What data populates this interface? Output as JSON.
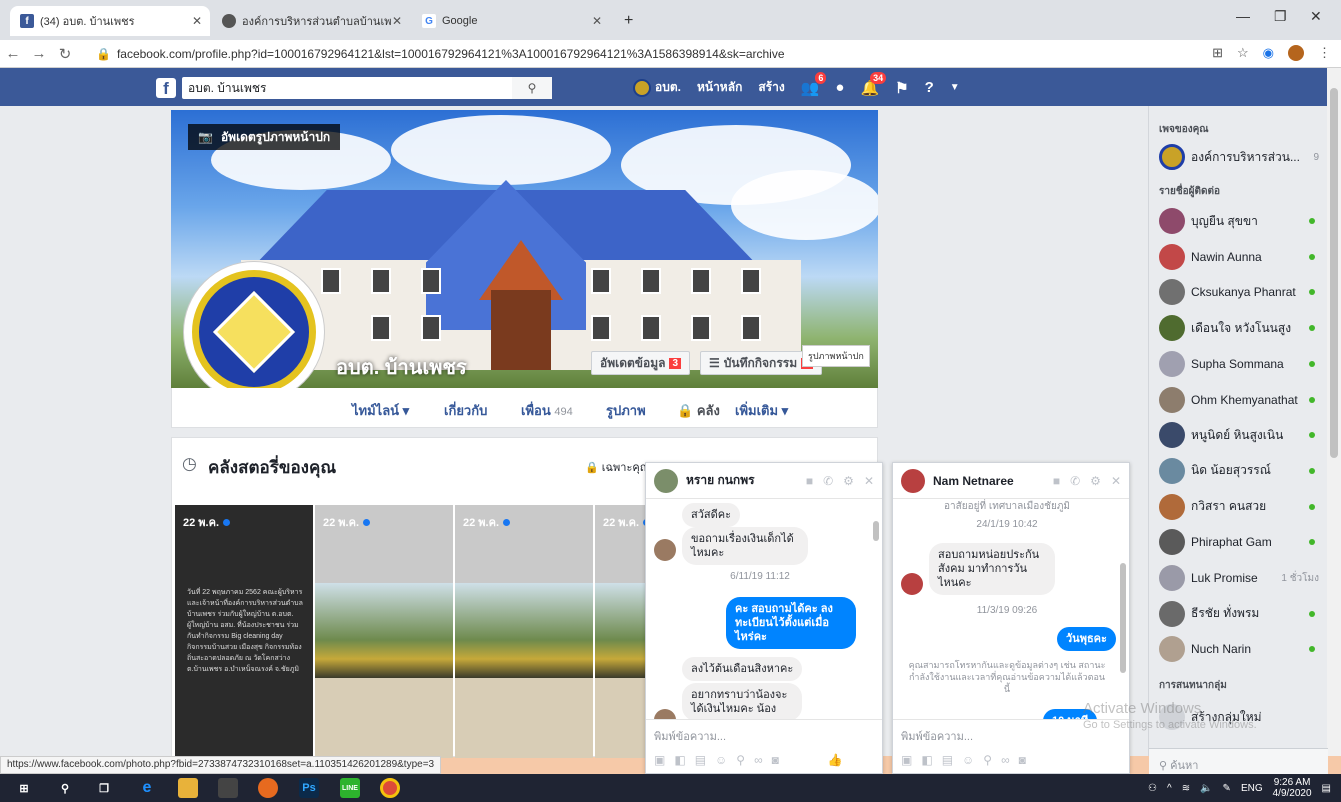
{
  "browser": {
    "tabs": [
      {
        "title": "(34) อบต. บ้านเพชร",
        "favicon": "facebook-icon"
      },
      {
        "title": "องค์การบริหารส่วนตำบลบ้านเพชร อำเ",
        "favicon": "globe-icon"
      },
      {
        "title": "Google",
        "favicon": "google-icon"
      }
    ],
    "url": "facebook.com/profile.php?id=100016792964121&lst=100016792964121%3A100016792964121%3A1586398914&sk=archive",
    "status_url": "https://www.facebook.com/photo.php?fbid=2733874732310168set=a.110351426201289&type=3"
  },
  "fb_header": {
    "logo": "f",
    "search_value": "อบต. บ้านเพชร",
    "profile_short": "อบต.",
    "home": "หน้าหลัก",
    "create": "สร้าง",
    "friend_requests_badge": "6",
    "notifications_badge": "34"
  },
  "profile": {
    "update_cover": "อัพเดตรูปภาพหน้าปก",
    "name": "อบต. บ้านเพชร",
    "update_info": "อัพเดตข้อมูล",
    "update_info_badge": "3",
    "activity_log": "บันทึกกิจกรรม",
    "tooltip": "รูปภาพหน้าปก",
    "nav": [
      {
        "label": "ไทม์ไลน์ ▾"
      },
      {
        "label": "เกี่ยวกับ"
      },
      {
        "label": "เพื่อน",
        "count": "494"
      },
      {
        "label": "รูปภาพ"
      },
      {
        "label": "คลัง"
      },
      {
        "label": "เพิ่มเติม ▾"
      }
    ]
  },
  "archive": {
    "title": "คลังสตอรี่ของคุณ",
    "privacy": "เฉพาะคุณ",
    "stories": [
      {
        "date": "22 พ.ค.",
        "text": "วันที่ 22 พฤษภาคม 2562 คณะผู้บริหาร และเจ้าหน้าที่องค์การบริหารส่วนตำบลบ้านเพชร ร่วมกับผู้ใหญ่บ้าน ต.อบต. ผู้ใหญ่บ้าน อสม. ที่น้องประชาชน ร่วมกันทำกิจกรรม Big cleaning day กิจกรรมบ้านสวย เมืองสุข กิจกรรมท้องถิ่นสะอาดปลอดภัย ณ วัดโคกสว่าง ต.บ้านเพชร อ.บำเหน็จณรงค์ จ.ชัยภูมิ"
      },
      {
        "date": "22 พ.ค."
      },
      {
        "date": "22 พ.ค."
      },
      {
        "date": "22 พ.ค."
      }
    ]
  },
  "chat1": {
    "name": "หราย กนกพร",
    "messages": [
      {
        "dir": "in",
        "text": "สวัสดีคะ"
      },
      {
        "dir": "in",
        "text": "ขอถามเรื่องเงินเด็กได้ไหมคะ"
      },
      {
        "dir": "ts",
        "text": "6/11/19 11:12"
      },
      {
        "dir": "out",
        "text": "คะ สอบถามได้คะ ลงทะเบียนไว้ตั้งแต่เมื่อไหร่คะ"
      },
      {
        "dir": "in",
        "text": "ลงไว้ต้นเดือนสิงหาคะ"
      },
      {
        "dir": "in",
        "text": "อยากทราบว่าน้องจะได้เงินไหมคะ น้อง"
      }
    ],
    "input_placeholder": "พิมพ์ข้อความ..."
  },
  "chat2": {
    "name": "Nam Netnaree",
    "messages": [
      {
        "dir": "in_top",
        "text": "อาสัยอยู่ที่ เทศบาลเมืองชัยภูมิ"
      },
      {
        "dir": "ts",
        "text": "24/1/19 10:42"
      },
      {
        "dir": "in",
        "text": "สอบถามหน่อยประกันสังคม มาทำการวันไหนคะ"
      },
      {
        "dir": "ts",
        "text": "11/3/19 09:26"
      },
      {
        "dir": "out",
        "text": "วันพุธคะ"
      },
      {
        "dir": "note",
        "text": "คุณสามารถโทรหากันและดูข้อมูลต่างๆ เช่น สถานะกำลังใช้งานและเวลาที่คุณอ่านข้อความได้แล้วตอนนี้"
      },
      {
        "dir": "out_partial",
        "text": "10 นาที"
      }
    ],
    "input_placeholder": "พิมพ์ข้อความ..."
  },
  "sidebar": {
    "pages_heading": "เพจของคุณ",
    "page_item": {
      "name": "องค์การบริหารส่วน...",
      "count": "9"
    },
    "contacts_heading": "รายชื่อผู้ติดต่อ",
    "contacts": [
      {
        "name": "บุญยืน สุขขา",
        "color": "#8e4a6b"
      },
      {
        "name": "Nawin Aunna",
        "color": "#c24848"
      },
      {
        "name": "Cksukanya Phanrat",
        "color": "#707070"
      },
      {
        "name": "เดือนใจ หวังโนนสูง",
        "color": "#4f6b2f"
      },
      {
        "name": "Supha Sommana",
        "color": "#a0a0b0"
      },
      {
        "name": "Ohm Khemyanathat",
        "color": "#8d7d6d"
      },
      {
        "name": "หนูนิดย์ หินสูงเนิน",
        "color": "#3a4a6a"
      },
      {
        "name": "นิด น้อยสุวรรณ์",
        "color": "#6a8aa0"
      },
      {
        "name": "กวิสรา คนสวย",
        "color": "#b06a3a"
      },
      {
        "name": "Phiraphat Gam",
        "color": "#5a5a5a"
      },
      {
        "name": "Luk Promise",
        "color": "#9a9aa8",
        "meta": "1 ชั่วโมง"
      },
      {
        "name": "ธีรชัย ทั่งพรม",
        "color": "#6a6a6a"
      },
      {
        "name": "Nuch Narin",
        "color": "#b0a090"
      }
    ],
    "groups_heading": "การสนทนากลุ่ม",
    "create_group": "สร้างกลุ่มใหม่",
    "search_placeholder": "ค้นหา"
  },
  "watermark": {
    "title": "Activate Windows",
    "sub": "Go to Settings to activate Windows."
  },
  "taskbar": {
    "lang": "ENG",
    "time": "9:26 AM",
    "date": "4/9/2020"
  }
}
